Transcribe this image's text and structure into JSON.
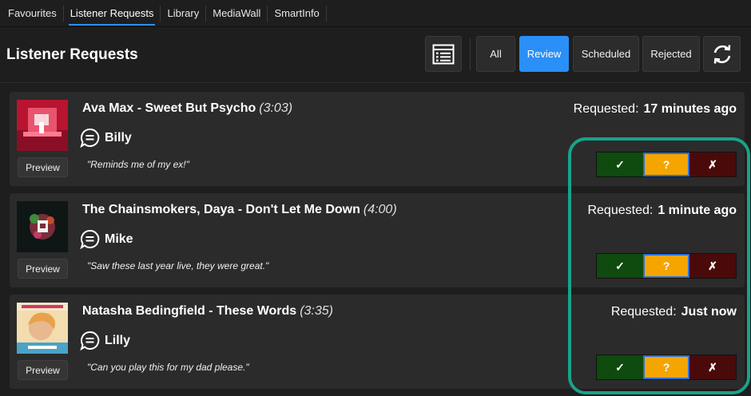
{
  "tabs": [
    {
      "label": "Favourites"
    },
    {
      "label": "Listener Requests"
    },
    {
      "label": "Library"
    },
    {
      "label": "MediaWall"
    },
    {
      "label": "SmartInfo"
    }
  ],
  "active_tab": "Listener Requests",
  "header": {
    "title": "Listener Requests",
    "filters": [
      {
        "label": "All"
      },
      {
        "label": "Review"
      },
      {
        "label": "Scheduled"
      },
      {
        "label": "Rejected"
      }
    ],
    "active_filter": "Review",
    "icons": [
      "list-view-icon",
      "refresh-icon"
    ]
  },
  "requests": [
    {
      "song": "Ava Max - Sweet But Psycho",
      "duration": "(3:03)",
      "user": "Billy",
      "note": "\"Reminds me of my ex!\"",
      "requested_label": "Requested:",
      "requested_time": "17 minutes ago",
      "preview_label": "Preview",
      "approve": "✓",
      "review": "?",
      "reject": "✗",
      "art_colors": [
        "#c41a3a",
        "#ff4f6d"
      ]
    },
    {
      "song": "The Chainsmokers, Daya - Don't Let Me Down",
      "duration": "(4:00)",
      "user": "Mike",
      "note": "\"Saw these last year live, they were great.\"",
      "requested_label": "Requested:",
      "requested_time": "1 minute ago",
      "preview_label": "Preview",
      "approve": "✓",
      "review": "?",
      "reject": "✗",
      "art_colors": [
        "#101a1a",
        "#e0e0e0"
      ]
    },
    {
      "song": "Natasha Bedingfield - These Words",
      "duration": "(3:35)",
      "user": "Lilly",
      "note": "\"Can you play this for my dad please.\"",
      "requested_label": "Requested:",
      "requested_time": "Just now",
      "preview_label": "Preview",
      "approve": "✓",
      "review": "?",
      "reject": "✗",
      "art_colors": [
        "#f1d6a4",
        "#5aa9c9"
      ]
    }
  ],
  "colors": {
    "accent": "#2a8ff7",
    "approve": "#0f4a0f",
    "review": "#f5a500",
    "reject": "#4a0a0a",
    "highlight": "#18a38a"
  }
}
